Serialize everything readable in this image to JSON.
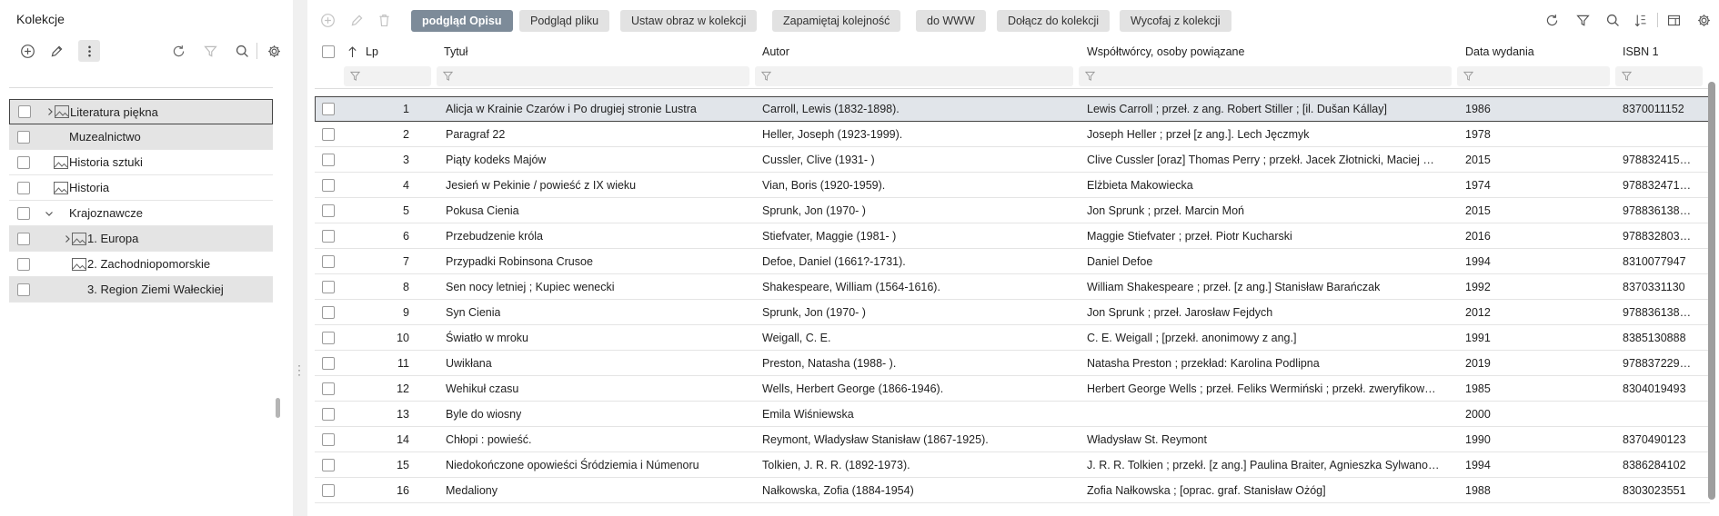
{
  "left_panel": {
    "title": "Kolekcje",
    "toolbar": {
      "add": "add-icon",
      "edit": "pencil-icon",
      "more": "more-vertical-icon",
      "refresh": "refresh-icon",
      "filter": "filter-icon",
      "search": "search-icon",
      "settings": "gear-icon"
    },
    "tree": [
      {
        "label": "Literatura piękna",
        "indent": 0,
        "expander": "right",
        "image": true,
        "shaded": true,
        "selected": true
      },
      {
        "label": "Muzealnictwo",
        "indent": 0,
        "expander": null,
        "image": false,
        "shaded": true,
        "selected": false
      },
      {
        "label": "Historia sztuki",
        "indent": 0,
        "expander": null,
        "image": true,
        "shaded": false,
        "selected": false
      },
      {
        "label": "Historia",
        "indent": 0,
        "expander": null,
        "image": true,
        "shaded": false,
        "selected": false
      },
      {
        "label": "Krajoznawcze",
        "indent": 0,
        "expander": "down",
        "image": false,
        "shaded": false,
        "selected": false
      },
      {
        "label": "1. Europa",
        "indent": 1,
        "expander": "right",
        "image": true,
        "shaded": true,
        "selected": false
      },
      {
        "label": "2. Zachodniopomorskie",
        "indent": 1,
        "expander": null,
        "image": true,
        "shaded": false,
        "selected": false
      },
      {
        "label": "3. Region Ziemi Wałeckiej",
        "indent": 1,
        "expander": null,
        "image": false,
        "shaded": true,
        "selected": false
      }
    ]
  },
  "toolbar": {
    "buttons": [
      {
        "label": "podgląd Opisu",
        "primary": true
      },
      {
        "label": "Podgląd pliku",
        "primary": false
      },
      {
        "label": "Ustaw obraz w kolekcji",
        "primary": false
      },
      {
        "label": "Zapamiętaj kolejność",
        "primary": false
      },
      {
        "label": "do WWW",
        "primary": false
      },
      {
        "label": "Dołącz do kolekcji",
        "primary": false
      },
      {
        "label": "Wycofaj z kolekcji",
        "primary": false
      }
    ],
    "left_icons": [
      "add-icon",
      "pencil-icon",
      "trash-icon"
    ],
    "right_icons": [
      "refresh-icon",
      "filter-icon",
      "search-icon",
      "sort-icon",
      "columns-icon",
      "gear-icon"
    ]
  },
  "grid": {
    "columns": [
      "Lp",
      "Tytuł",
      "Autor",
      "Współtwórcy, osoby powiązane",
      "Data wydania",
      "ISBN 1"
    ],
    "sort_column": "Lp",
    "rows": [
      {
        "lp": "1",
        "title": "Alicja w Krainie Czarów i Po drugiej stronie Lustra",
        "author": "Carroll, Lewis (1832-1898).",
        "contributors": "Lewis Carroll ; przeł. z ang. Robert Stiller ; [il. Dušan Kállay]",
        "date": "1986",
        "isbn": "8370011152"
      },
      {
        "lp": "2",
        "title": "Paragraf 22",
        "author": "Heller, Joseph (1923-1999).",
        "contributors": "Joseph Heller ; przeł [z ang.]. Lech Jęczmyk",
        "date": "1978",
        "isbn": ""
      },
      {
        "lp": "3",
        "title": "Piąty kodeks Majów",
        "author": "Cussler, Clive (1931- )",
        "contributors": "Clive Cussler [oraz] Thomas Perry ; przekł. Jacek Złotnicki, Maciej …",
        "date": "2015",
        "isbn": "978832415…"
      },
      {
        "lp": "4",
        "title": "Jesień w Pekinie /  powieść z IX wieku",
        "author": "Vian, Boris (1920-1959).",
        "contributors": "Elżbieta Makowiecka",
        "date": "1974",
        "isbn": "978832471…"
      },
      {
        "lp": "5",
        "title": "Pokusa Cienia",
        "author": "Sprunk, Jon (1970- )",
        "contributors": "Jon Sprunk ; przeł. Marcin Moń",
        "date": "2015",
        "isbn": "978836138…"
      },
      {
        "lp": "6",
        "title": "Przebudzenie króla",
        "author": "Stiefvater, Maggie (1981- )",
        "contributors": "Maggie Stiefvater ; przeł. Piotr Kucharski",
        "date": "2016",
        "isbn": "978832803…"
      },
      {
        "lp": "7",
        "title": "Przypadki Robinsona Crusoe",
        "author": "Defoe, Daniel (1661?-1731).",
        "contributors": "Daniel Defoe",
        "date": "1994",
        "isbn": "8310077947"
      },
      {
        "lp": "8",
        "title": "Sen nocy letniej ; Kupiec wenecki",
        "author": "Shakespeare, William (1564-1616).",
        "contributors": "William Shakespeare ; przeł. [z ang.] Stanisław Barańczak",
        "date": "1992",
        "isbn": "8370331130"
      },
      {
        "lp": "9",
        "title": "Syn Cienia",
        "author": "Sprunk, Jon (1970- )",
        "contributors": "Jon Sprunk ; przeł. Jarosław Fejdych",
        "date": "2012",
        "isbn": "978836138…"
      },
      {
        "lp": "10",
        "title": "Światło w mroku",
        "author": "Weigall, C. E.",
        "contributors": "C. E. Weigall ; [przekł. anonimowy z ang.]",
        "date": "1991",
        "isbn": "8385130888"
      },
      {
        "lp": "11",
        "title": "Uwikłana",
        "author": "Preston, Natasha (1988- ).",
        "contributors": "Natasha Preston ; przekład: Karolina Podlipna",
        "date": "2019",
        "isbn": "978837229…"
      },
      {
        "lp": "12",
        "title": "Wehikuł czasu",
        "author": "Wells, Herbert George (1866-1946).",
        "contributors": "Herbert George Wells ; przeł. Feliks Wermiński ; przekł. zweryfikow…",
        "date": "1985",
        "isbn": "8304019493"
      },
      {
        "lp": "13",
        "title": "Byle do wiosny",
        "author": "Emila Wiśniewska",
        "contributors": "",
        "date": "2000",
        "isbn": ""
      },
      {
        "lp": "14",
        "title": "Chłopi : powieść.",
        "author": "Reymont, Władysław Stanisław (1867-1925).",
        "contributors": "Władysław St. Reymont",
        "date": "1990",
        "isbn": "8370490123"
      },
      {
        "lp": "15",
        "title": "Niedokończone opowieści Śródziemia i Númenoru",
        "author": "Tolkien, J. R. R. (1892-1973).",
        "contributors": "J. R. R. Tolkien ; przekł. [z ang.] Paulina Braiter, Agnieszka Sylwano…",
        "date": "1994",
        "isbn": "8386284102"
      },
      {
        "lp": "16",
        "title": "Medaliony",
        "author": "Nałkowska, Zofia (1884-1954)",
        "contributors": "Zofia Nałkowska ; [oprac. graf. Stanisław Ożóg]",
        "date": "1988",
        "isbn": "8303023551"
      }
    ]
  }
}
